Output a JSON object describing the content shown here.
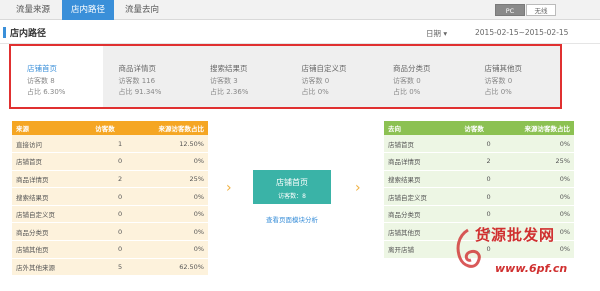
{
  "tabs": [
    {
      "label": "流量来源",
      "active": false
    },
    {
      "label": "店内路径",
      "active": true
    },
    {
      "label": "流量去向",
      "active": false
    }
  ],
  "device": {
    "pc": "PC",
    "wireless": "无线"
  },
  "section": {
    "title": "店内路径",
    "date_label": "日期",
    "date_range": "2015-02-15~2015-02-15"
  },
  "cards": [
    {
      "title": "店铺首页",
      "visitors": "访客数 8",
      "ratio": "占比 6.30%"
    },
    {
      "title": "商品详情页",
      "visitors": "访客数 116",
      "ratio": "占比 91.34%"
    },
    {
      "title": "搜索结果页",
      "visitors": "访客数 3",
      "ratio": "占比 2.36%"
    },
    {
      "title": "店铺自定义页",
      "visitors": "访客数 0",
      "ratio": "占比 0%"
    },
    {
      "title": "商品分类页",
      "visitors": "访客数 0",
      "ratio": "占比 0%"
    },
    {
      "title": "店铺其他页",
      "visitors": "访客数 0",
      "ratio": "占比 0%"
    }
  ],
  "source_table": {
    "headers": [
      "来源",
      "访客数",
      "来源访客数占比"
    ],
    "rows": [
      [
        "直接访问",
        "1",
        "12.50%"
      ],
      [
        "店铺首页",
        "0",
        "0%"
      ],
      [
        "商品详情页",
        "2",
        "25%"
      ],
      [
        "搜索结果页",
        "0",
        "0%"
      ],
      [
        "店铺自定义页",
        "0",
        "0%"
      ],
      [
        "商品分类页",
        "0",
        "0%"
      ],
      [
        "店铺其他页",
        "0",
        "0%"
      ],
      [
        "店外其他来源",
        "5",
        "62.50%"
      ]
    ]
  },
  "center": {
    "title": "店铺首页",
    "sub": "访客数：8",
    "link": "查看页面模块分析"
  },
  "dest_table": {
    "headers": [
      "去向",
      "访客数",
      "来源访客数占比"
    ],
    "rows": [
      [
        "店铺首页",
        "0",
        "0%"
      ],
      [
        "商品详情页",
        "2",
        "25%"
      ],
      [
        "搜索结果页",
        "0",
        "0%"
      ],
      [
        "店铺自定义页",
        "0",
        "0%"
      ],
      [
        "商品分类页",
        "0",
        "0%"
      ],
      [
        "店铺其他页",
        "0",
        "0%"
      ],
      [
        "离开店铺",
        "0",
        "0%"
      ]
    ]
  },
  "watermark": {
    "line1": "货源批发网",
    "line2": "www.6pf.cn"
  },
  "colors": {
    "accent": "#3a8fd9",
    "source_header": "#f5a623",
    "dest_header": "#8cc152",
    "center_box": "#3ab3a7",
    "highlight": "#e03030"
  }
}
